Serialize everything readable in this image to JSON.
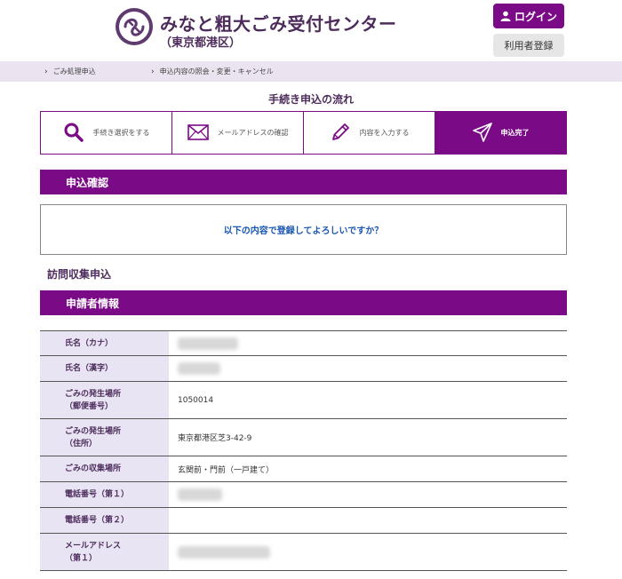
{
  "header": {
    "logo_icon": "minato-ward-emblem-icon",
    "title": "みなと粗大ごみ受付センター",
    "subtitle": "（東京都港区）",
    "login_label": "ログイン",
    "register_label": "利用者登録"
  },
  "breadcrumb": {
    "items": [
      {
        "label": "ごみ処理申込"
      },
      {
        "label": "申込内容の照会・変更・キャンセル"
      }
    ]
  },
  "flow": {
    "title": "手続き申込の流れ",
    "steps": [
      {
        "label": "手続き選択をする",
        "icon": "search-icon"
      },
      {
        "label": "メールアドレスの確認",
        "icon": "envelope-icon"
      },
      {
        "label": "内容を入力する",
        "icon": "pencil-icon"
      },
      {
        "label": "申込完了",
        "icon": "paper-plane-icon"
      }
    ]
  },
  "confirm_section": {
    "heading": "申込確認",
    "message": "以下の内容で登録してよろしいですか？"
  },
  "collection": {
    "heading": "訪問収集申込"
  },
  "applicant": {
    "heading": "申請者情報",
    "rows": [
      {
        "label1": "氏名（カナ）",
        "label2": "",
        "value": "",
        "masked": true
      },
      {
        "label1": "氏名（漢字）",
        "label2": "",
        "value": "",
        "masked": true
      },
      {
        "label1": "ごみの発生場所",
        "label2": "（郵便番号）",
        "value": "1050014",
        "masked": false
      },
      {
        "label1": "ごみの発生場所",
        "label2": "（住所）",
        "value": "東京都港区芝3-42-9",
        "masked": false
      },
      {
        "label1": "ごみの収集場所",
        "label2": "",
        "value": "玄関前・門前（一戸建て）",
        "masked": false
      },
      {
        "label1": "電話番号（第１）",
        "label2": "",
        "value": "",
        "masked": true
      },
      {
        "label1": "電話番号（第２）",
        "label2": "",
        "value": "",
        "masked": false
      },
      {
        "label1": "メールアドレス",
        "label2": "（第１）",
        "value": "",
        "masked": true
      }
    ]
  },
  "colors": {
    "accent": "#7b0a87",
    "brand_text": "#4d2c5c",
    "breadcrumb_bg": "#ebe4f0",
    "label_bg": "#e8e4f4",
    "link_blue": "#1a56b0"
  }
}
